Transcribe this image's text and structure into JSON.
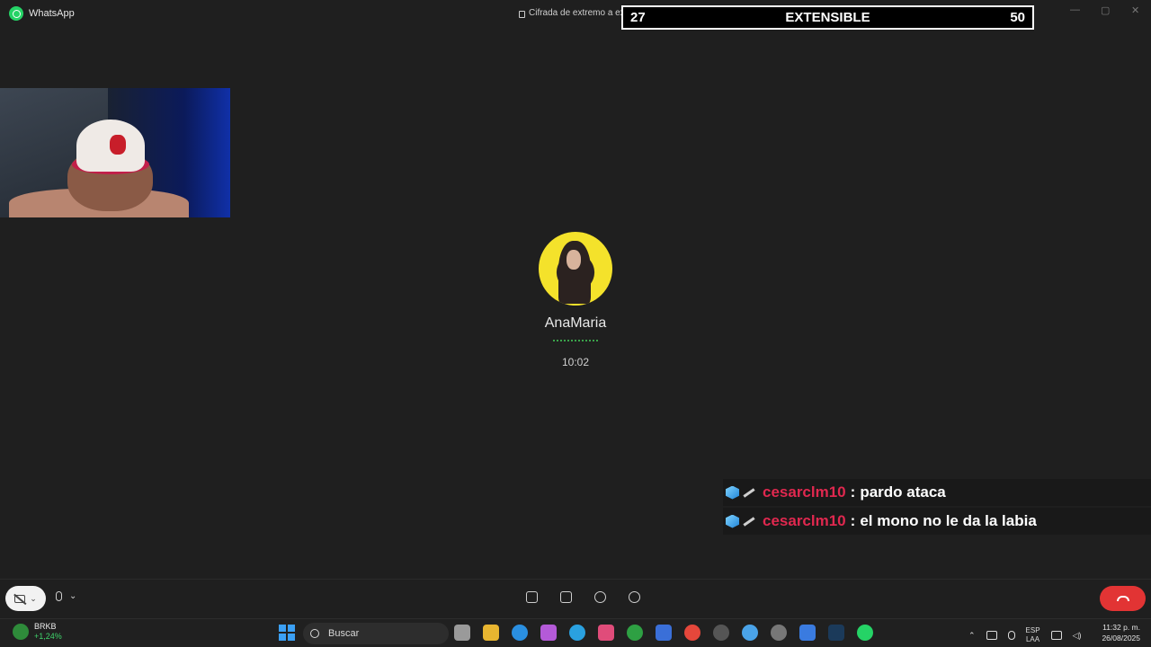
{
  "window": {
    "app_name": "WhatsApp",
    "encryption_notice": "Cifrada de extremo a extre"
  },
  "stream_overlay": {
    "left_number": "27",
    "center_label": "EXTENSIBLE",
    "right_number": "50"
  },
  "call": {
    "contact_name": "AnaMaria",
    "duration": "10:02"
  },
  "chat": {
    "messages": [
      {
        "user": "cesarclm10",
        "separator": ":",
        "text": "pardo ataca"
      },
      {
        "user": "cesarclm10",
        "separator": ":",
        "text": "el mono no le da la labia"
      }
    ]
  },
  "controls": {
    "camera": "camera-off-icon",
    "mic": "mic-icon",
    "middle_icons": [
      "raise-hand-icon",
      "share-screen-icon",
      "add-person-icon",
      "chat-icon"
    ],
    "end_call": "end-call-icon",
    "end_call_color": "#e23434"
  },
  "taskbar": {
    "stock_ticker": "BRKB",
    "stock_change": "+1,24%",
    "search_placeholder": "Buscar",
    "language": "ESP",
    "layout": "LAA",
    "time": "11:32 p. m.",
    "date": "26/08/2025"
  },
  "colors": {
    "chat_username": "#e0284f",
    "avatar_bg": "#f4e22b"
  }
}
